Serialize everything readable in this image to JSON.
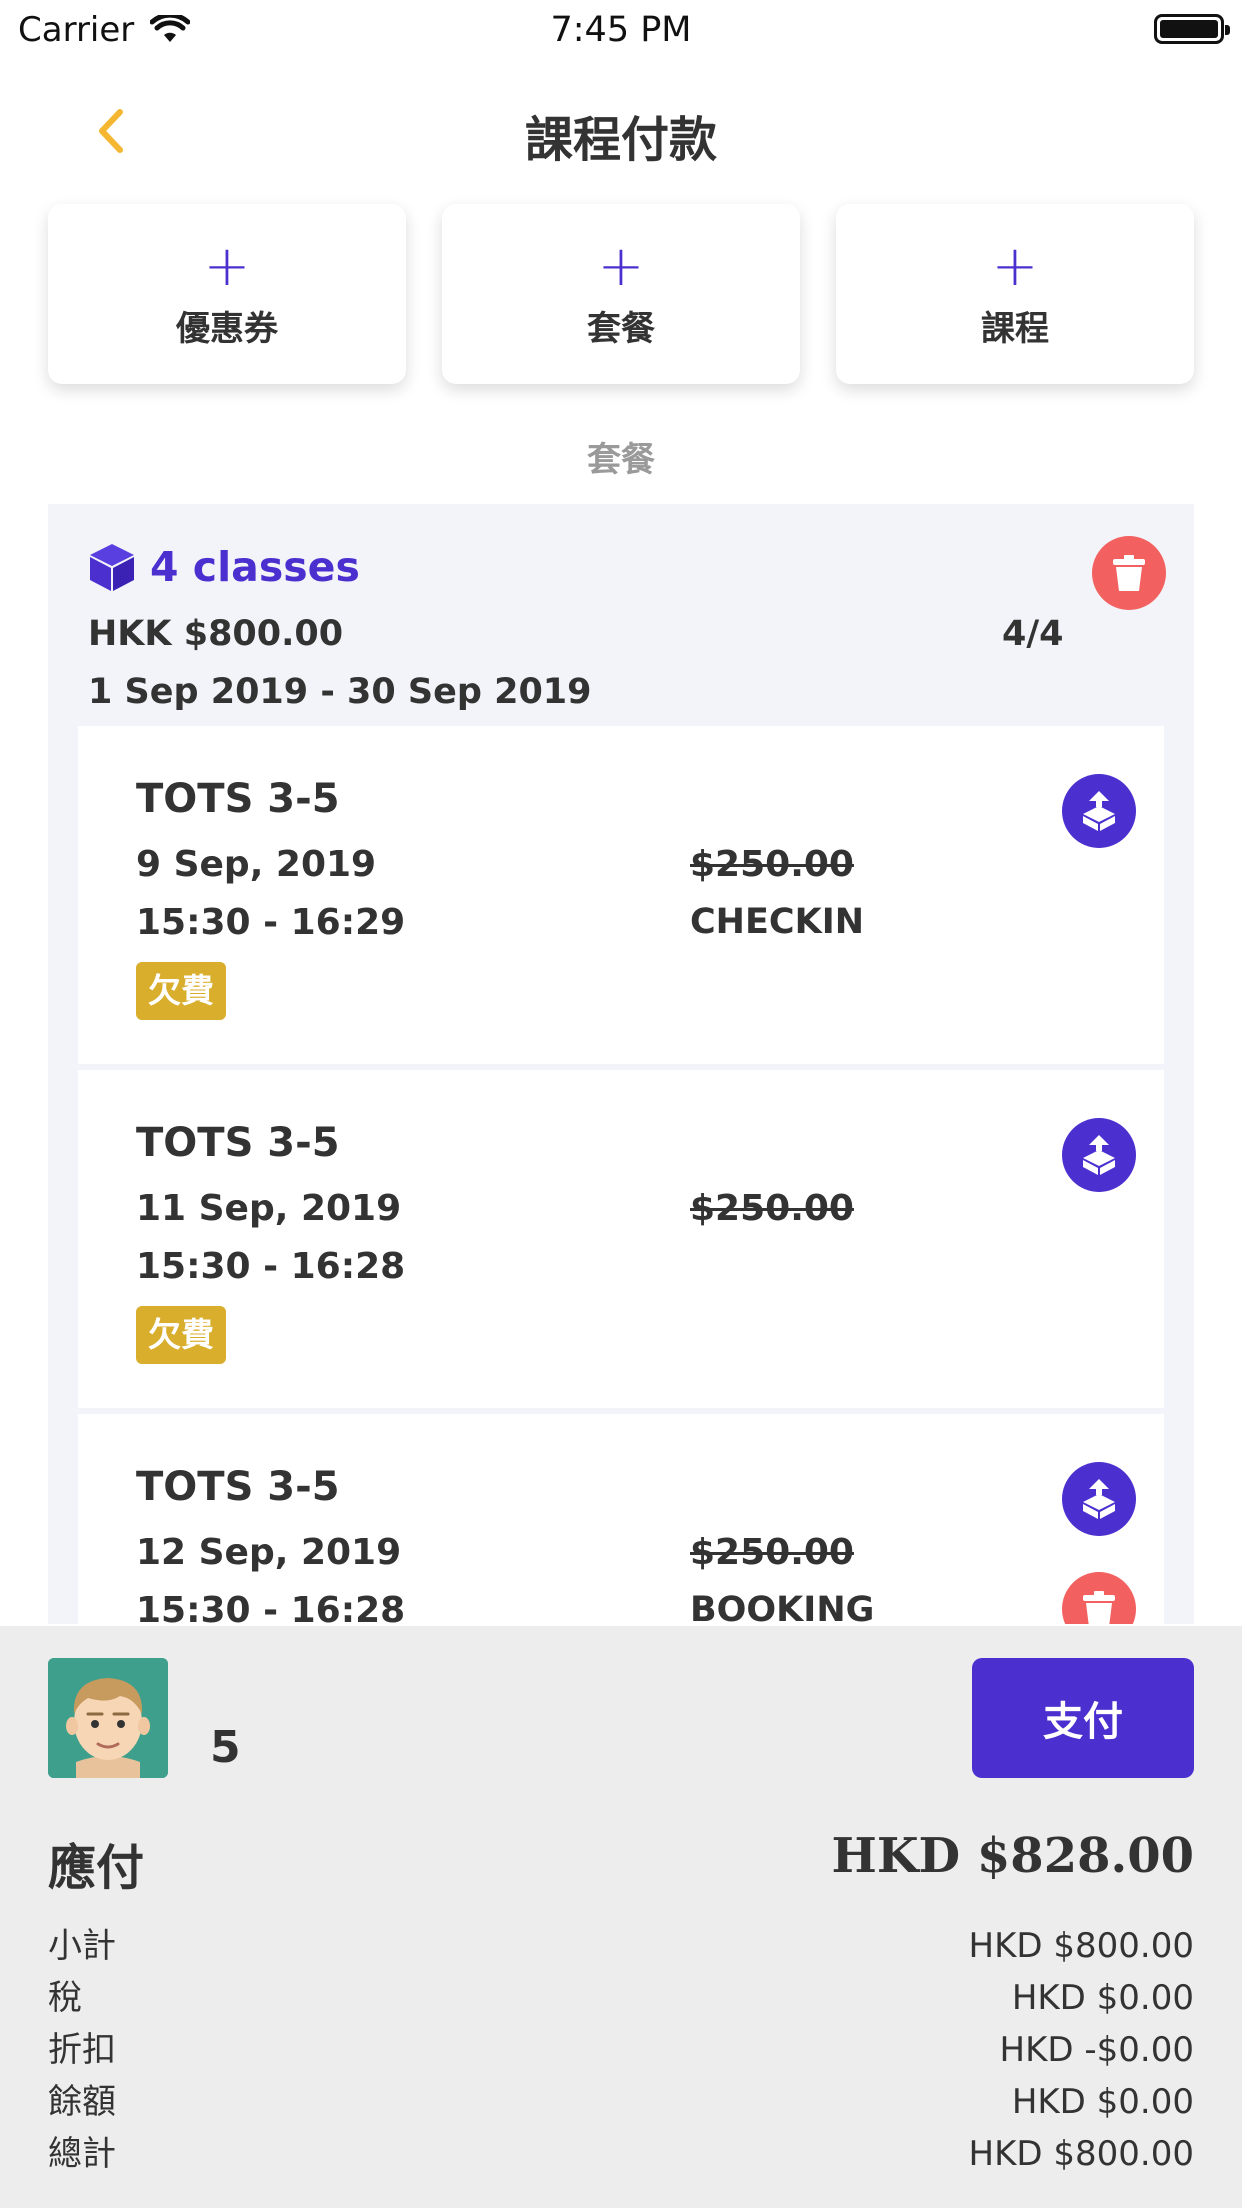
{
  "status_bar": {
    "carrier": "Carrier",
    "time": "7:45 PM"
  },
  "nav": {
    "title": "課程付款"
  },
  "add_buttons": [
    {
      "plus": "+",
      "label": "優惠券"
    },
    {
      "plus": "+",
      "label": "套餐"
    },
    {
      "plus": "+",
      "label": "課程"
    }
  ],
  "section_label": "套餐",
  "package": {
    "name": "4 classes",
    "price": "HKK $800.00",
    "count": "4/4",
    "dates": "1 Sep 2019 - 30 Sep 2019",
    "classes": [
      {
        "title": "TOTS 3-5",
        "date": "9 Sep, 2019",
        "time": "15:30 - 16:29",
        "price": "$250.00",
        "status": "CHECKIN",
        "badge": "欠費"
      },
      {
        "title": "TOTS 3-5",
        "date": "11 Sep, 2019",
        "time": "15:30 - 16:28",
        "price": "$250.00",
        "status": "",
        "badge": "欠費"
      },
      {
        "title": "TOTS 3-5",
        "date": "12 Sep, 2019",
        "time": "15:30 - 16:28",
        "price": "$250.00",
        "status": "BOOKING",
        "badge": ""
      }
    ]
  },
  "bottom": {
    "quantity": "5",
    "pay_label": "支付",
    "due_label": "應付",
    "due_amount": "HKD $828.00",
    "summary": [
      {
        "label": "小計",
        "value": "HKD $800.00"
      },
      {
        "label": "稅",
        "value": "HKD $0.00"
      },
      {
        "label": "折扣",
        "value": "HKD -$0.00"
      },
      {
        "label": "餘額",
        "value": "HKD $0.00"
      },
      {
        "label": "總計",
        "value": "HKD $800.00"
      }
    ]
  },
  "colors": {
    "accent": "#4b2fcf",
    "danger": "#f2615f",
    "badge": "#d9ae2c",
    "back_arrow": "#f5b731"
  },
  "icons": [
    "wifi-icon",
    "battery-icon",
    "back-chevron-icon",
    "cube-icon",
    "trash-icon",
    "move-package-icon",
    "avatar-icon"
  ]
}
